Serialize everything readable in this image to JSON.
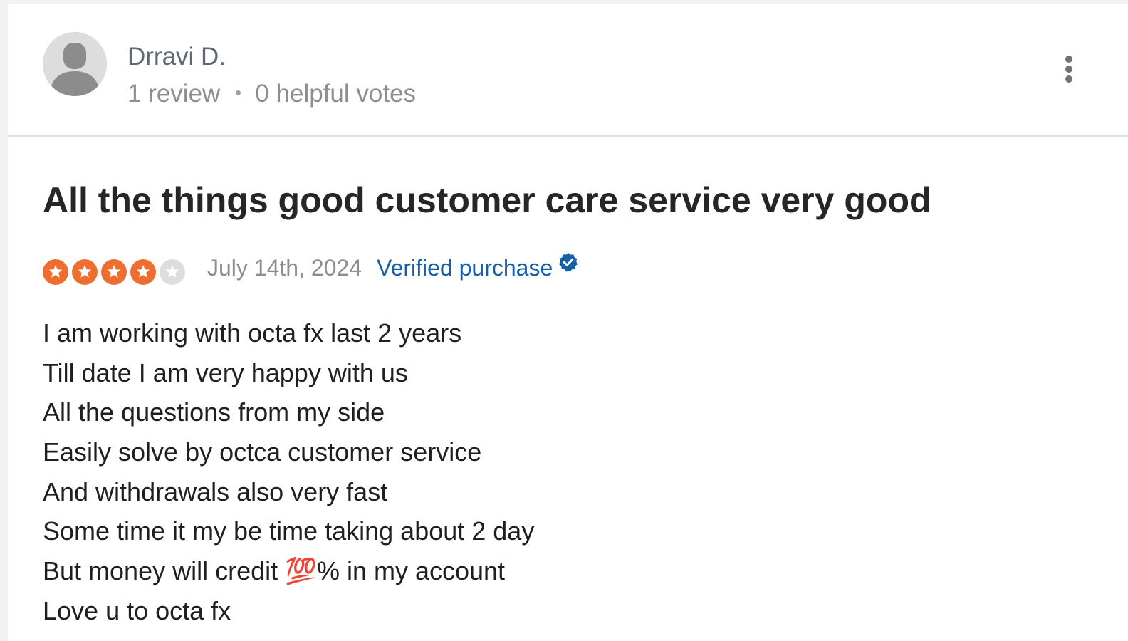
{
  "reviewer": {
    "name": "Drravi D.",
    "review_count": "1 review",
    "helpful_votes": "0 helpful votes"
  },
  "review": {
    "title": "All the things good customer care service very good",
    "rating": 4,
    "max_rating": 5,
    "date": "July 14th, 2024",
    "verified_label": "Verified purchase",
    "body_lines": [
      "I am working with octa fx last 2 years",
      "Till date I am very happy with us",
      "All the questions from my side",
      "Easily solve by octca customer service",
      "And withdrawals also very fast",
      "Some time it my be time taking about 2 day",
      "But money will credit 💯% in my account",
      "Love u to octa fx"
    ]
  },
  "icons": {
    "avatar": "default-user-avatar",
    "more": "vertical-ellipsis-icon",
    "star": "star-icon",
    "verified": "checkmark-badge-icon"
  },
  "colors": {
    "star_filled": "#ed6e2f",
    "star_empty": "#dddddd",
    "verified_text": "#1560a8",
    "title_text": "#262626"
  }
}
